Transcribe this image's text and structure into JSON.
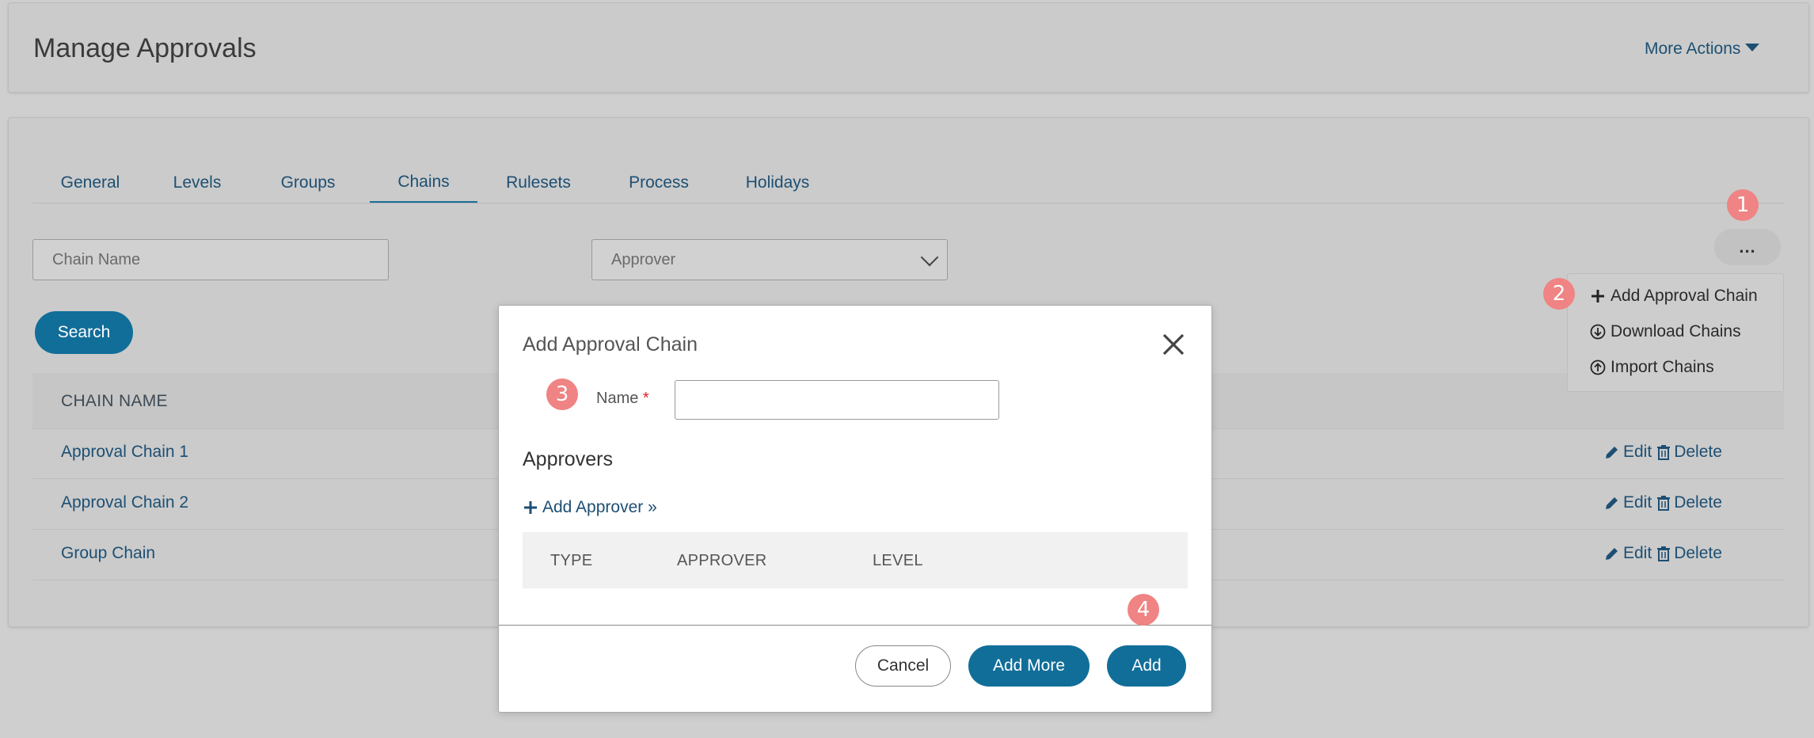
{
  "header": {
    "title": "Manage Approvals",
    "more_actions_label": "More Actions"
  },
  "tabs": [
    {
      "label": "General"
    },
    {
      "label": "Levels"
    },
    {
      "label": "Groups"
    },
    {
      "label": "Chains",
      "active": true
    },
    {
      "label": "Rulesets"
    },
    {
      "label": "Process"
    },
    {
      "label": "Holidays"
    }
  ],
  "filters": {
    "chain_name_placeholder": "Chain Name",
    "approver_selected": "Approver",
    "search_label": "Search"
  },
  "table": {
    "column_header": "CHAIN NAME",
    "rows": [
      {
        "name": "Approval Chain 1"
      },
      {
        "name": "Approval Chain 2"
      },
      {
        "name": "Group Chain"
      }
    ],
    "edit_label": "Edit",
    "delete_label": "Delete"
  },
  "actions_menu": {
    "button_label": "...",
    "items": [
      {
        "label": "Add Approval Chain",
        "icon": "plus-icon"
      },
      {
        "label": "Download Chains",
        "icon": "download-circle-icon"
      },
      {
        "label": "Import Chains",
        "icon": "upload-circle-icon"
      }
    ]
  },
  "modal": {
    "title": "Add Approval Chain",
    "name_label": "Name",
    "required_mark": "*",
    "name_value": "",
    "approvers_heading": "Approvers",
    "add_approver_label": "Add Approver »",
    "columns": [
      "TYPE",
      "APPROVER",
      "LEVEL"
    ],
    "cancel_label": "Cancel",
    "add_more_label": "Add More",
    "add_label": "Add"
  },
  "badges": [
    "1",
    "2",
    "3",
    "4"
  ],
  "colors": {
    "primary": "#116e99",
    "link": "#1d4f73",
    "badge": "#f08383",
    "backdrop": "#cfcfcf"
  }
}
